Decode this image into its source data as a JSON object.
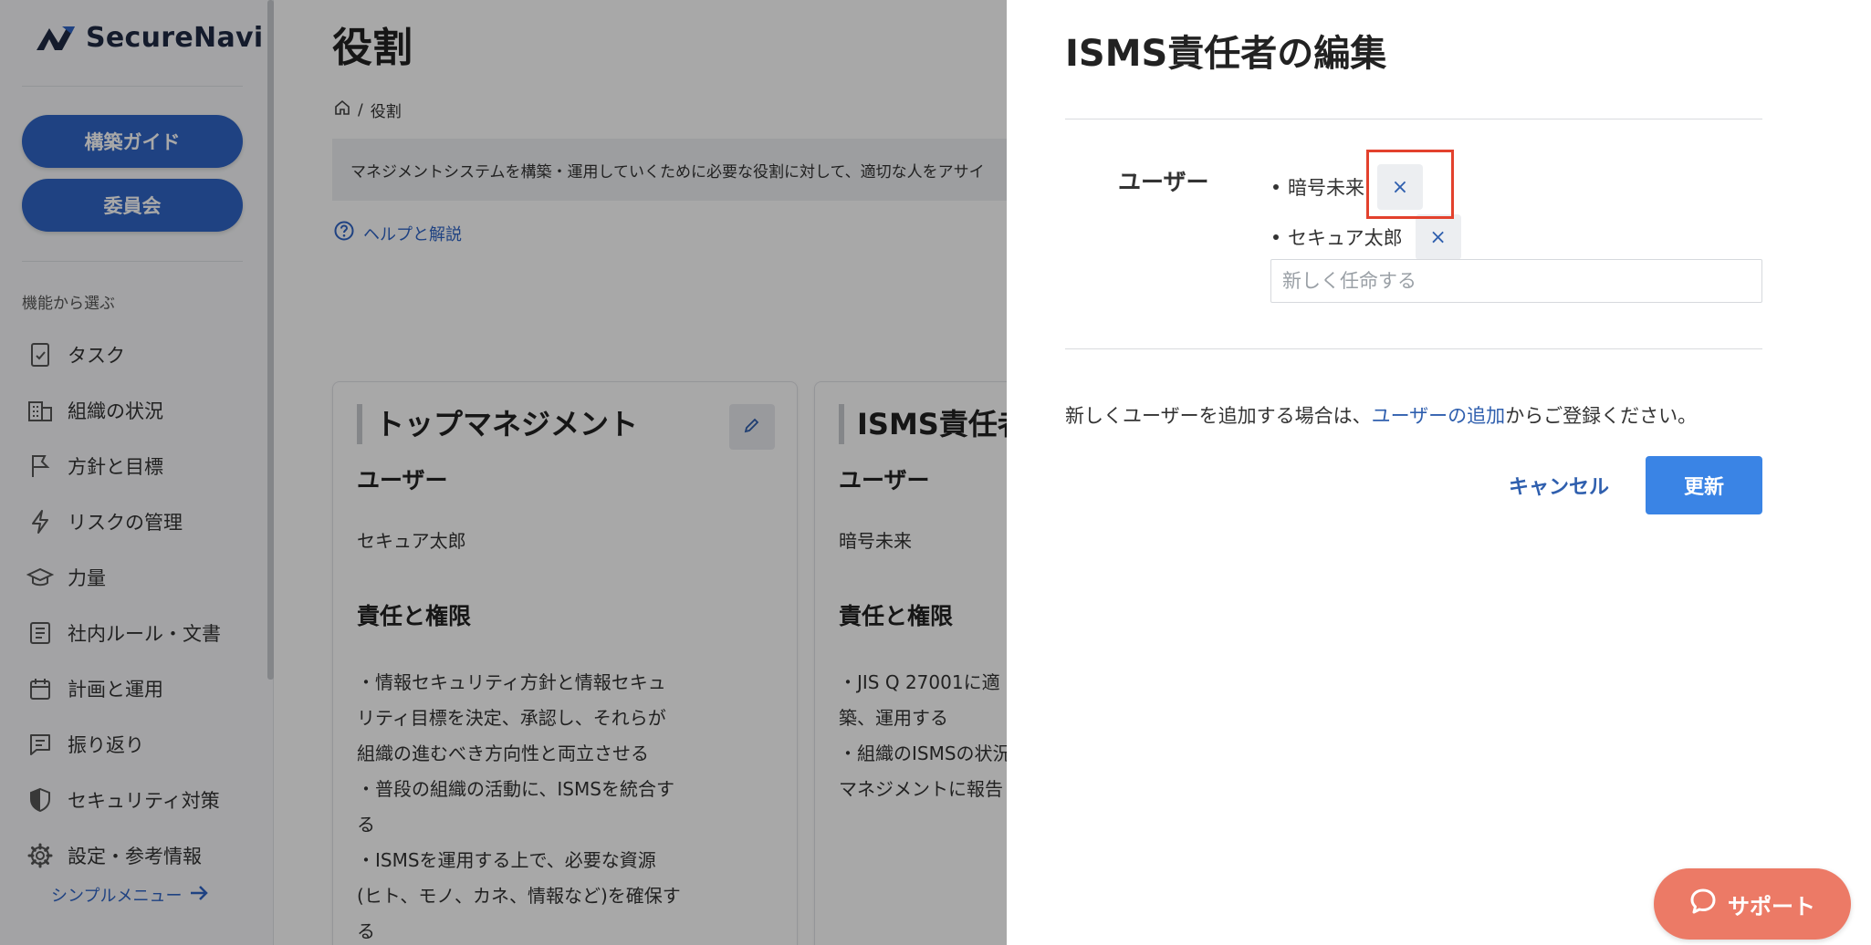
{
  "brand": {
    "name": "SecureNavi"
  },
  "sidebar": {
    "guide_button": "構築ガイド",
    "committee_button": "委員会",
    "section_caption": "機能から選ぶ",
    "items": [
      {
        "label": "タスク",
        "icon": "task-icon"
      },
      {
        "label": "組織の状況",
        "icon": "building-icon"
      },
      {
        "label": "方針と目標",
        "icon": "flag-icon"
      },
      {
        "label": "リスクの管理",
        "icon": "bolt-icon"
      },
      {
        "label": "力量",
        "icon": "graduation-cap-icon"
      },
      {
        "label": "社内ルール・文書",
        "icon": "document-icon"
      },
      {
        "label": "計画と運用",
        "icon": "calendar-icon"
      },
      {
        "label": "振り返り",
        "icon": "review-icon"
      },
      {
        "label": "セキュリティ対策",
        "icon": "shield-icon"
      },
      {
        "label": "設定・参考情報",
        "icon": "gear-icon"
      }
    ],
    "simple_menu": "シンプルメニュー"
  },
  "main": {
    "title": "役割",
    "breadcrumb": "役割",
    "description": "マネジメントシステムを構築・運用していくために必要な役割に対して、適切な人をアサイ",
    "help_link": "ヘルプと解説",
    "cards": [
      {
        "title": "トップマネジメント",
        "user_heading": "ユーザー",
        "user": "セキュア太郎",
        "duty_heading": "責任と権限",
        "body_lines": [
          "・情報セキュリティ方針と情報セキュ",
          "リティ目標を決定、承認し、それらが",
          "組織の進むべき方向性と両立させる",
          "・普段の組織の活動に、ISMSを統合す",
          "る",
          "・ISMSを運用する上で、必要な資源",
          "(ヒト、モノ、カネ、情報など)を確保す",
          "る"
        ]
      },
      {
        "title": "ISMS責任者",
        "user_heading": "ユーザー",
        "user": "暗号未来",
        "duty_heading": "責任と権限",
        "body_lines": [
          "・JIS Q 27001に適",
          "築、運用する",
          "・組織のISMSの状況",
          "マネジメントに報告"
        ]
      }
    ]
  },
  "drawer": {
    "title": "ISMS責任者の編集",
    "field_label": "ユーザー",
    "assignees": [
      "暗号未来",
      "セキュア太郎"
    ],
    "remove_symbol": "×",
    "input_placeholder": "新しく任命する",
    "note_prefix": "新しくユーザーを追加する場合は、",
    "note_link": "ユーザーの追加",
    "note_suffix": "からご登録ください。",
    "cancel": "キャンセル",
    "update": "更新"
  },
  "support": {
    "label": "サポート"
  }
}
